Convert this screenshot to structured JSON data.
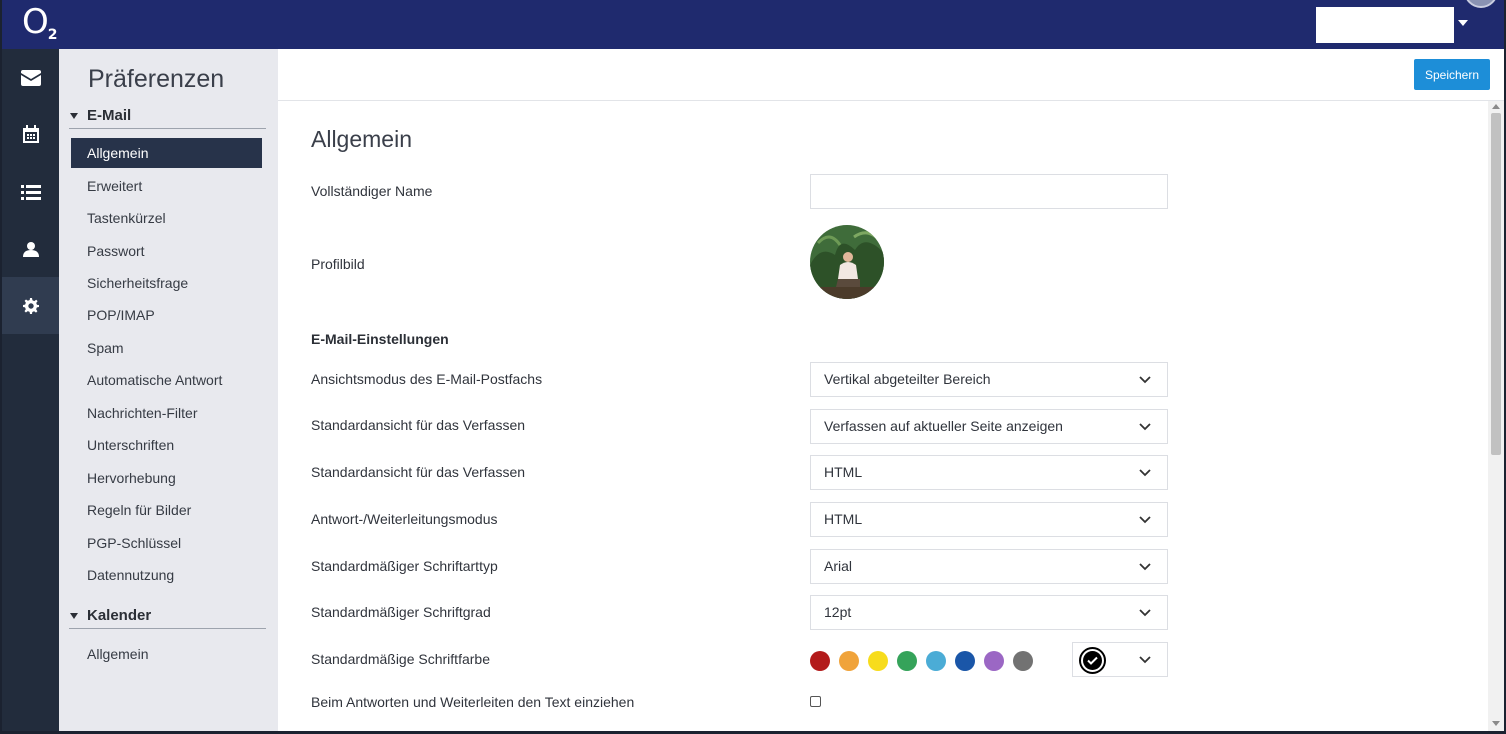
{
  "topbar": {
    "logo_text": "O",
    "logo_sub": "2"
  },
  "rail": {
    "items": [
      "mail-icon",
      "calendar-icon",
      "list-icon",
      "contact-icon",
      "gear-icon"
    ],
    "active": "gear-icon"
  },
  "sidebar": {
    "title": "Präferenzen",
    "sections": [
      {
        "label": "E-Mail",
        "items": [
          "Allgemein",
          "Erweitert",
          "Tastenkürzel",
          "Passwort",
          "Sicherheitsfrage",
          "POP/IMAP",
          "Spam",
          "Automatische Antwort",
          "Nachrichten-Filter",
          "Unterschriften",
          "Hervorhebung",
          "Regeln für Bilder",
          "PGP-Schlüssel",
          "Datennutzung"
        ],
        "active": "Allgemein"
      },
      {
        "label": "Kalender",
        "items": [
          "Allgemein"
        ]
      }
    ]
  },
  "toolbar": {
    "save_label": "Speichern"
  },
  "main": {
    "heading": "Allgemein",
    "full_name_label": "Vollständiger Name",
    "full_name_value": "",
    "profile_label": "Profilbild",
    "email_settings_heading": "E-Mail-Einstellungen",
    "rows": [
      {
        "label": "Ansichtsmodus des E-Mail-Postfachs",
        "value": "Vertikal abgeteilter Bereich"
      },
      {
        "label": "Standardansicht für das Verfassen",
        "value": "Verfassen auf aktueller Seite anzeigen"
      },
      {
        "label": "Standardansicht für das Verfassen",
        "value": "HTML"
      },
      {
        "label": "Antwort-/Weiterleitungsmodus",
        "value": "HTML"
      },
      {
        "label": "Standardmäßiger Schriftarttyp",
        "value": "Arial"
      },
      {
        "label": "Standardmäßiger Schriftgrad",
        "value": "12pt"
      }
    ],
    "font_color_label": "Standardmäßige Schriftfarbe",
    "font_colors": [
      "#b31b1b",
      "#f0a33a",
      "#f7dc1c",
      "#35a35a",
      "#4bacd6",
      "#1a56a8",
      "#9b67c4",
      "#727272"
    ],
    "selected_font_color": "#000000",
    "indent_label": "Beim Antworten und Weiterleiten den Text einziehen",
    "indent_checked": false
  },
  "colors": {
    "topbar": "#1f2a6e",
    "accent": "#1d8ed8",
    "sidebar_active": "#27334a"
  }
}
